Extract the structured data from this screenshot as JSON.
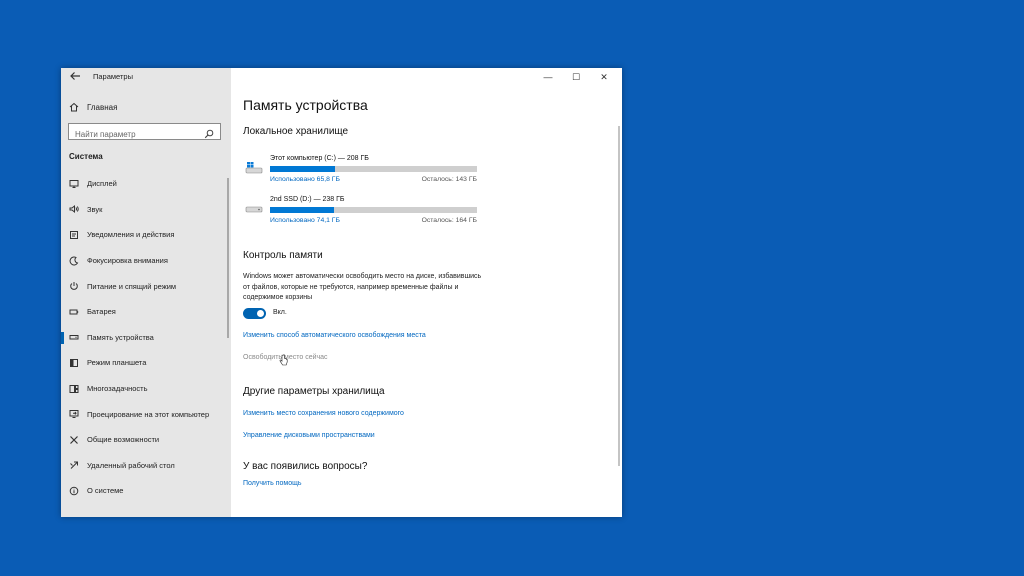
{
  "window": {
    "title": "Параметры",
    "controls": {
      "minimize": "—",
      "maximize": "☐",
      "close": "✕"
    }
  },
  "sidebar": {
    "back_icon": "back-arrow-icon",
    "home": {
      "label": "Главная",
      "icon": "home-icon"
    },
    "search": {
      "placeholder": "Найти параметр"
    },
    "group": "Система",
    "items": [
      {
        "label": "Дисплей",
        "icon": "display-icon"
      },
      {
        "label": "Звук",
        "icon": "sound-icon"
      },
      {
        "label": "Уведомления и действия",
        "icon": "notifications-icon"
      },
      {
        "label": "Фокусировка внимания",
        "icon": "focus-assist-icon"
      },
      {
        "label": "Питание и спящий режим",
        "icon": "power-icon"
      },
      {
        "label": "Батарея",
        "icon": "battery-icon"
      },
      {
        "label": "Память устройства",
        "icon": "storage-icon",
        "active": true
      },
      {
        "label": "Режим планшета",
        "icon": "tablet-icon"
      },
      {
        "label": "Многозадачность",
        "icon": "multitasking-icon"
      },
      {
        "label": "Проецирование на этот компьютер",
        "icon": "projecting-icon"
      },
      {
        "label": "Общие возможности",
        "icon": "shared-experiences-icon"
      },
      {
        "label": "Удаленный рабочий стол",
        "icon": "remote-desktop-icon"
      },
      {
        "label": "О системе",
        "icon": "about-icon"
      }
    ]
  },
  "main": {
    "page_title": "Память устройства",
    "local_storage": {
      "title": "Локальное хранилище",
      "drives": [
        {
          "name": "Этот компьютер (C:) — 208 ГБ",
          "used": "Использовано 65,8 ГБ",
          "free": "Осталось: 143 ГБ",
          "used_fraction": 0.316,
          "icon": "system-drive-icon"
        },
        {
          "name": "2nd SSD (D:) — 238 ГБ",
          "used": "Использовано 74,1 ГБ",
          "free": "Осталось: 164 ГБ",
          "used_fraction": 0.311,
          "icon": "drive-icon"
        }
      ]
    },
    "storage_sense": {
      "title": "Контроль памяти",
      "description": "Windows может автоматически освободить место на диске, избавившись от файлов, которые не требуются, например временные файлы и содержимое корзины",
      "toggle_label": "Вкл.",
      "toggle_on": true,
      "change_link": "Изменить способ автоматического освобождения места",
      "free_now_link": "Освободить место сейчас"
    },
    "more_settings": {
      "title": "Другие параметры хранилища",
      "links": [
        "Изменить место сохранения нового содержимого",
        "Управление дисковыми пространствами"
      ]
    },
    "questions": {
      "title": "У вас появились вопросы?",
      "help_link": "Получить помощь"
    }
  },
  "colors": {
    "desktop": "#0a5cb5",
    "accent": "#0078d4",
    "link": "#0067c0",
    "sidebar_bg": "#e6e6e6"
  }
}
